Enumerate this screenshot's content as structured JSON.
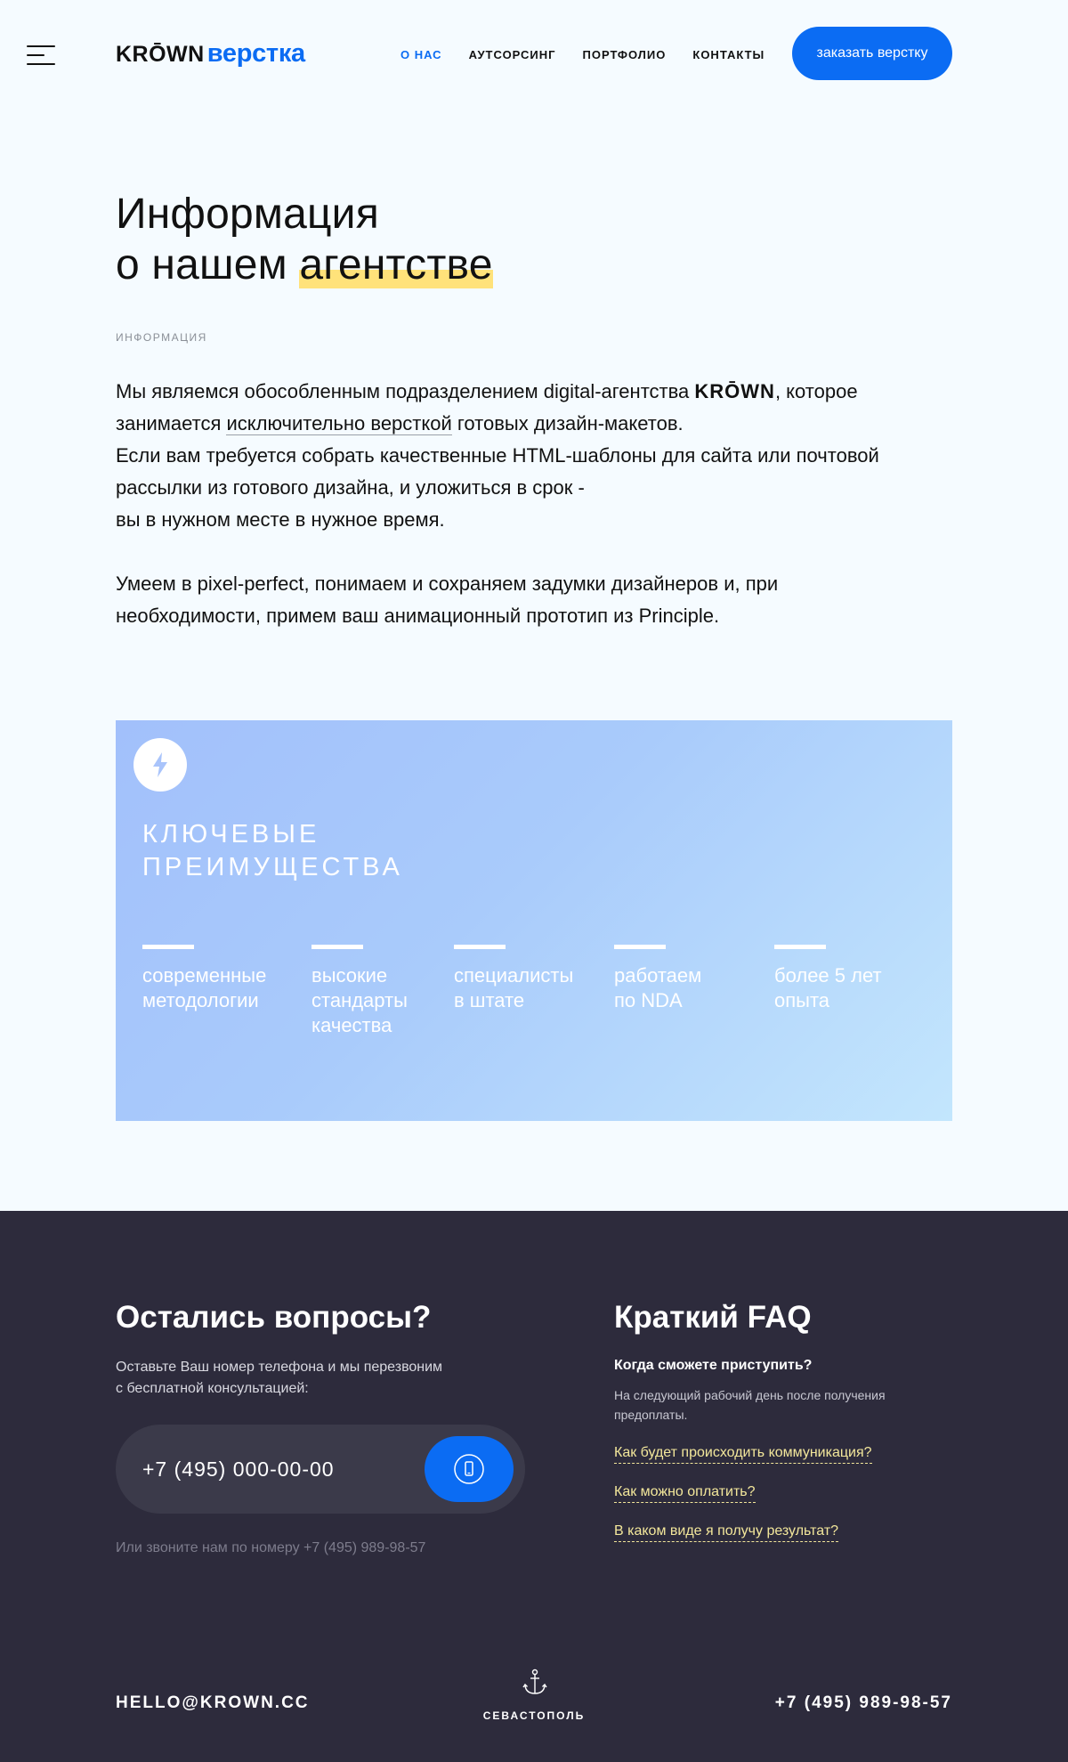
{
  "header": {
    "logo_brand": "KRŌWN",
    "logo_sub": "верстка",
    "nav": [
      "О НАС",
      "АУТСОРСИНГ",
      "ПОРТФОЛИО",
      "КОНТАКТЫ"
    ],
    "cta_label": "заказать верстку"
  },
  "intro": {
    "title_line1": "Информация",
    "title_line2_prefix": "о нашем ",
    "title_line2_highlight": "агентстве",
    "eyebrow": "ИНФОРМАЦИЯ",
    "p1_part1": "Мы являемся обособленным подразделением digital-агентства ",
    "p1_brand": "KRŌWN",
    "p1_part2": ", которое занимается ",
    "p1_link": "исключительно версткой",
    "p1_part3": " готовых дизайн-макетов.",
    "p1_line2": "Если вам требуется собрать качественные HTML-шаблоны для сайта или почтовой рассылки из готового дизайна, и уложиться в срок -",
    "p1_line3": "вы в нужном месте в нужное время.",
    "p2": "Умеем в pixel-perfect, понимаем и сохраняем задумки дизайнеров и, при необходимости, примем ваш анимационный прототип из Principle."
  },
  "advantages": {
    "icon": "lightning-icon",
    "title_line1": "КЛЮЧЕВЫЕ",
    "title_line2": "ПРЕИМУЩЕСТВА",
    "items": [
      {
        "line1": "современные",
        "line2": "методологии",
        "line3": ""
      },
      {
        "line1": "высокие",
        "line2": "стандарты",
        "line3": "качества"
      },
      {
        "line1": "специалисты",
        "line2": "в штате",
        "line3": ""
      },
      {
        "line1": "работаем",
        "line2": "по NDA",
        "line3": ""
      },
      {
        "line1": "более 5 лет",
        "line2": "опыта",
        "line3": ""
      }
    ]
  },
  "contact": {
    "title": "Остались вопросы?",
    "text_line1": "Оставьте Ваш номер телефона и мы перезвоним",
    "text_line2": "с бесплатной консультацией:",
    "phone_placeholder": "+7 (495) 000-00-00",
    "call_icon": "phone-icon",
    "alt": "Или звоните нам по номеру +7 (495) 989-98-57"
  },
  "faq": {
    "title": "Краткий FAQ",
    "question": "Когда сможете приступить?",
    "answer": "На следующий рабочий день после получения предоплаты.",
    "links": [
      "Как будет происходить коммуникация?",
      "Как можно оплатить?",
      "В каком виде я получу результат?"
    ]
  },
  "footer": {
    "email": "HELLO@KROWN.CC",
    "city": "СЕВАСТОПОЛЬ",
    "city_icon": "anchor-icon",
    "phone": "+7 (495) 989-98-57"
  },
  "colors": {
    "accent": "#0b6cf3",
    "highlight": "#ffe27a",
    "footer_bg": "#2d2b3c",
    "faq_link": "#f3e79b"
  }
}
